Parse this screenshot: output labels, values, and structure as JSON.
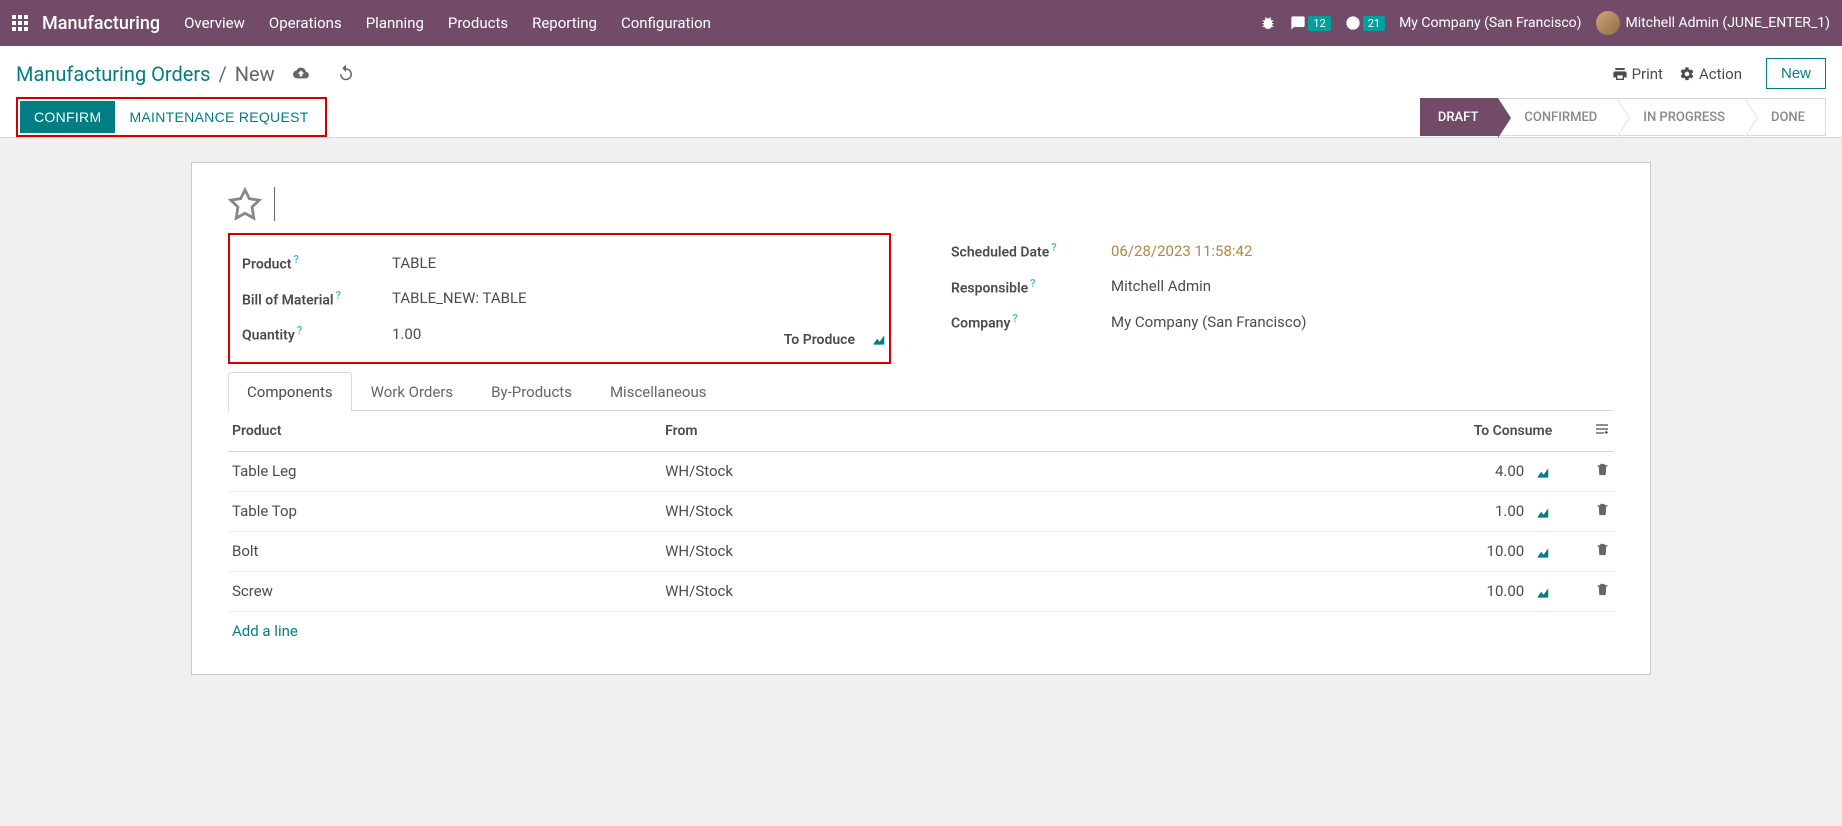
{
  "topbar": {
    "app_title": "Manufacturing",
    "menu": [
      "Overview",
      "Operations",
      "Planning",
      "Products",
      "Reporting",
      "Configuration"
    ],
    "messages_badge": "12",
    "activities_badge": "21",
    "company": "My Company (San Francisco)",
    "user": "Mitchell Admin (JUNE_ENTER_1)"
  },
  "breadcrumb": {
    "root": "Manufacturing Orders",
    "current": "New"
  },
  "cp_buttons": {
    "print": "Print",
    "action": "Action",
    "new": "New"
  },
  "action_bar": {
    "confirm": "CONFIRM",
    "maintenance": "MAINTENANCE REQUEST"
  },
  "statusbar": [
    "DRAFT",
    "CONFIRMED",
    "IN PROGRESS",
    "DONE"
  ],
  "form": {
    "product_label": "Product",
    "product_value": "TABLE",
    "bom_label": "Bill of Material",
    "bom_value": "TABLE_NEW: TABLE",
    "qty_label": "Quantity",
    "qty_value": "1.00",
    "to_produce": "To Produce",
    "scheduled_label": "Scheduled Date",
    "scheduled_value": "06/28/2023 11:58:42",
    "responsible_label": "Responsible",
    "responsible_value": "Mitchell Admin",
    "company_label": "Company",
    "company_value": "My Company (San Francisco)"
  },
  "tabs": [
    "Components",
    "Work Orders",
    "By-Products",
    "Miscellaneous"
  ],
  "components": {
    "headers": {
      "product": "Product",
      "from": "From",
      "to_consume": "To Consume"
    },
    "rows": [
      {
        "product": "Table Leg",
        "from": "WH/Stock",
        "qty": "4.00"
      },
      {
        "product": "Table Top",
        "from": "WH/Stock",
        "qty": "1.00"
      },
      {
        "product": "Bolt",
        "from": "WH/Stock",
        "qty": "10.00"
      },
      {
        "product": "Screw",
        "from": "WH/Stock",
        "qty": "10.00"
      }
    ],
    "add_line": "Add a line"
  }
}
